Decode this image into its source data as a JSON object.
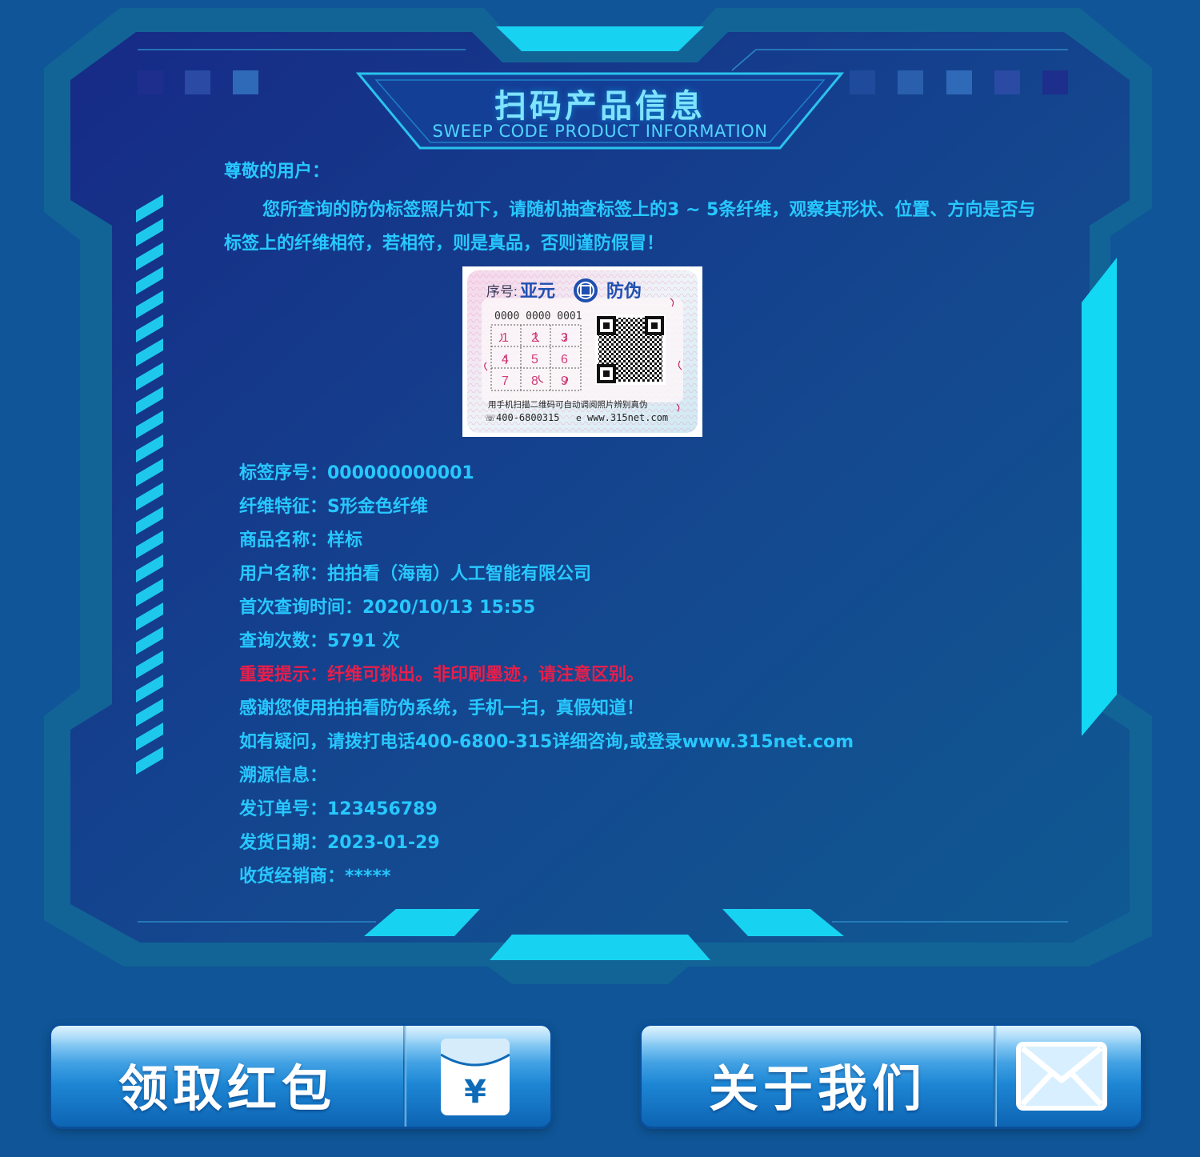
{
  "header": {
    "title_cn": "扫码产品信息",
    "title_en": "SWEEP CODE PRODUCT INFORMATION"
  },
  "intro": {
    "greeting": "尊敬的用户：",
    "text": "您所查询的防伪标签照片如下，请随机抽查标签上的3 ~ 5条纤维，观察其形状、位置、方向是否与标签上的纤维相符，若相符，则是真品，否则谨防假冒！"
  },
  "label_image": {
    "serial_prefix": "序号:",
    "brand": "亚元",
    "brand_suffix": "防伪",
    "code": "0000 0000 0001",
    "digits": [
      "1",
      "2",
      "3",
      "4",
      "5",
      "6",
      "7",
      "8",
      "9"
    ],
    "caption": "用手机扫描二维码可自动调阅照片辨别真伪",
    "phone": "400-6800315",
    "website": "www.315net.com"
  },
  "info": [
    {
      "text": "标签序号：000000000001",
      "type": "normal"
    },
    {
      "text": "纤维特征：S形金色纤维",
      "type": "normal"
    },
    {
      "text": "商品名称：样标",
      "type": "normal"
    },
    {
      "text": "用户名称：拍拍看（海南）人工智能有限公司",
      "type": "normal"
    },
    {
      "text": "首次查询时间：2020/10/13 15:55",
      "type": "normal"
    },
    {
      "text": "查询次数：5791 次",
      "type": "normal"
    },
    {
      "text": "重要提示：纤维可挑出。非印刷墨迹，请注意区别。",
      "type": "warn"
    },
    {
      "text": "感谢您使用拍拍看防伪系统，手机一扫，真假知道！",
      "type": "normal"
    },
    {
      "text": "如有疑问，请拨打电话400-6800-315详细咨询,或登录www.315net.com",
      "type": "normal"
    },
    {
      "text": "溯源信息：",
      "type": "normal"
    },
    {
      "text": "发订单号：123456789",
      "type": "normal"
    },
    {
      "text": "发货日期：2023-01-29",
      "type": "normal"
    },
    {
      "text": "收货经销商：*****",
      "type": "normal"
    }
  ],
  "buttons": {
    "red_packet": {
      "label": "领取红包",
      "icon": "red-packet-icon"
    },
    "about_us": {
      "label": "关于我们",
      "icon": "mail-icon"
    }
  },
  "colors": {
    "background": "#0f5597",
    "panel": "#16338a",
    "accent_cyan": "#12d8f4",
    "text": "#27c8ff",
    "warning": "#e81e4a"
  }
}
